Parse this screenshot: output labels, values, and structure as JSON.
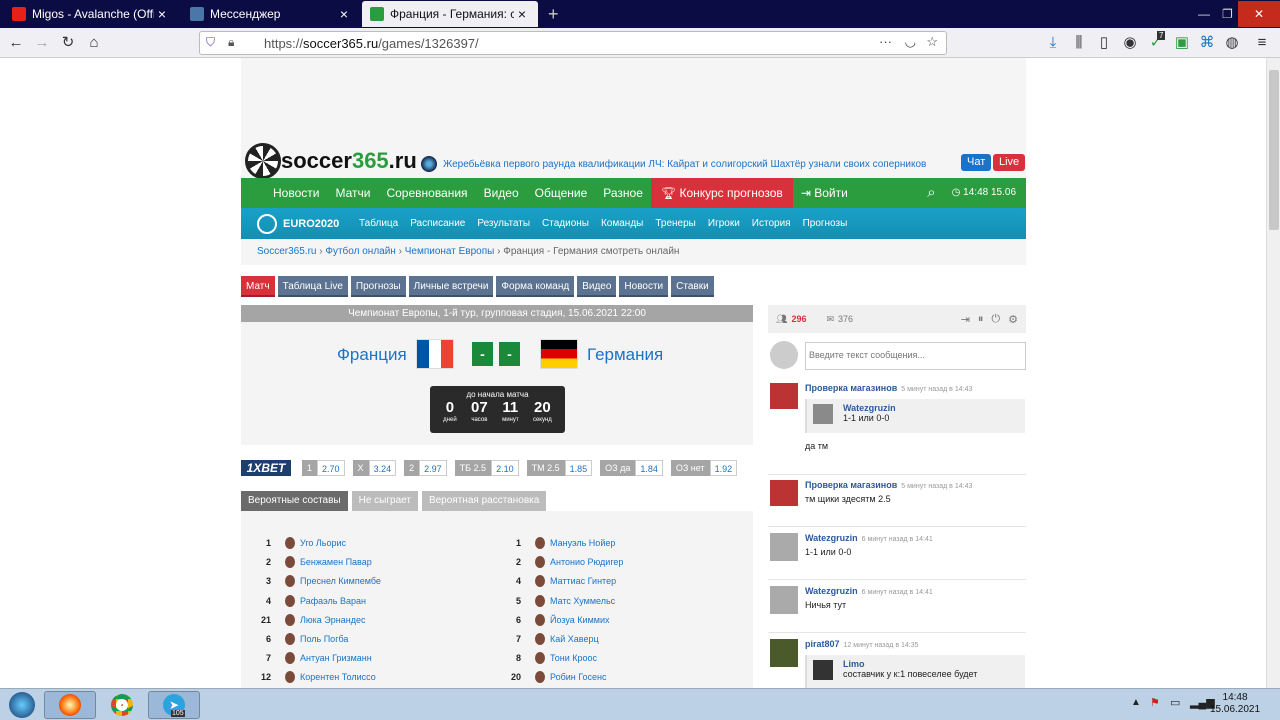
{
  "browser": {
    "tabs": [
      {
        "title": "Migos - Avalanche (Official Vid",
        "icon": "youtube-icon",
        "color": "#e62117"
      },
      {
        "title": "Мессенджер",
        "icon": "vk-icon",
        "color": "#4a76a8"
      },
      {
        "title": "Франция - Германия: смотрет",
        "icon": "soccer-icon",
        "color": "#2b9d3f"
      }
    ],
    "url_prefix": "https://",
    "url_domain": "soccer365.ru",
    "url_path": "/games/1326397/",
    "badge_count": "7"
  },
  "site": {
    "logo_text": "soccer",
    "logo_num": "365",
    "logo_tld": ".ru",
    "news_ticker": "Жеребьёвка первого раунда квалификации ЛЧ: Кайрат и солигорский Шахтёр узнали своих соперников",
    "chat_btn": "Чат",
    "live_btn": "Live",
    "nav": [
      "Новости",
      "Матчи",
      "Соревнования",
      "Видео",
      "Общение",
      "Разное"
    ],
    "promo": "Конкурс прогнозов",
    "login": "Войти",
    "time": "14:48 15.06",
    "euro_logo": "EURO2020",
    "euro_nav": [
      "Таблица",
      "Расписание",
      "Результаты",
      "Стадионы",
      "Команды",
      "Тренеры",
      "Игроки",
      "История",
      "Прогнозы"
    ],
    "breadcrumb": [
      "Soccer365.ru",
      "Футбол онлайн",
      "Чемпионат Европы"
    ],
    "breadcrumb_current": "Франция - Германия смотреть онлайн"
  },
  "match": {
    "tabs": [
      "Матч",
      "Таблица Live",
      "Прогнозы",
      "Личные встречи",
      "Форма команд",
      "Видео",
      "Новости",
      "Ставки"
    ],
    "header": "Чемпионат Европы, 1-й тур, групповая стадия, 15.06.2021 22:00",
    "home": "Франция",
    "away": "Германия",
    "home_score": "-",
    "away_score": "-",
    "countdown_title": "до начала матча",
    "countdown": [
      {
        "n": "0",
        "l": "дней"
      },
      {
        "n": "07",
        "l": "часов"
      },
      {
        "n": "11",
        "l": "минут"
      },
      {
        "n": "20",
        "l": "секунд"
      }
    ],
    "bookmaker": "1XBET",
    "odds": [
      {
        "k": "1",
        "v": "2.70"
      },
      {
        "k": "X",
        "v": "3.24"
      },
      {
        "k": "2",
        "v": "2.97"
      },
      {
        "k": "ТБ 2.5",
        "v": "2.10"
      },
      {
        "k": "ТМ 2.5",
        "v": "1.85"
      },
      {
        "k": "ОЗ да",
        "v": "1.84"
      },
      {
        "k": "ОЗ нет",
        "v": "1.92"
      }
    ],
    "lineup_tabs": [
      "Вероятные составы",
      "Не сыграет",
      "Вероятная расстановка"
    ],
    "home_players": [
      {
        "n": "1",
        "name": "Уго Льорис"
      },
      {
        "n": "2",
        "name": "Бенжамен Павар"
      },
      {
        "n": "3",
        "name": "Преснел Кимпембе"
      },
      {
        "n": "4",
        "name": "Рафаэль Варан"
      },
      {
        "n": "21",
        "name": "Люка Эрнандес"
      },
      {
        "n": "6",
        "name": "Поль Погба"
      },
      {
        "n": "7",
        "name": "Антуан Гризманн"
      },
      {
        "n": "12",
        "name": "Корентен Толиссо"
      }
    ],
    "away_players": [
      {
        "n": "1",
        "name": "Мануэль Нойер"
      },
      {
        "n": "2",
        "name": "Антонио Рюдигер"
      },
      {
        "n": "4",
        "name": "Маттиас Гинтер"
      },
      {
        "n": "5",
        "name": "Матс Хуммельс"
      },
      {
        "n": "6",
        "name": "Йозуа Киммих"
      },
      {
        "n": "7",
        "name": "Кай Хаверц"
      },
      {
        "n": "8",
        "name": "Тони Кроос"
      },
      {
        "n": "20",
        "name": "Робин Госенс"
      }
    ]
  },
  "chat": {
    "online": "296",
    "messages_count": "376",
    "input_placeholder": "Введите текст сообщения...",
    "messages": [
      {
        "author": "Проверка магазинов",
        "time": "5 минут назад в 14:43",
        "quote_author": "Watezgruzin",
        "quote_text": "1-1 или 0-0",
        "text": "да тм"
      },
      {
        "author": "Проверка магазинов",
        "time": "5 минут назад в 14:43",
        "text": "тм щики здесятм 2.5"
      },
      {
        "author": "Watezgruzin",
        "time": "6 минут назад в 14:41",
        "text": "1-1 или 0-0"
      },
      {
        "author": "Watezgruzin",
        "time": "6 минут назад в 14:41",
        "text": "Ничья тут"
      },
      {
        "author": "pirat807",
        "time": "12 минут назад в 14:35",
        "quote_author": "Limo",
        "quote_text": "составчик у к:1 повеселее будет"
      }
    ]
  },
  "taskbar": {
    "time": "14:48",
    "date": "15.06.2021",
    "telegram_badge": "105"
  }
}
